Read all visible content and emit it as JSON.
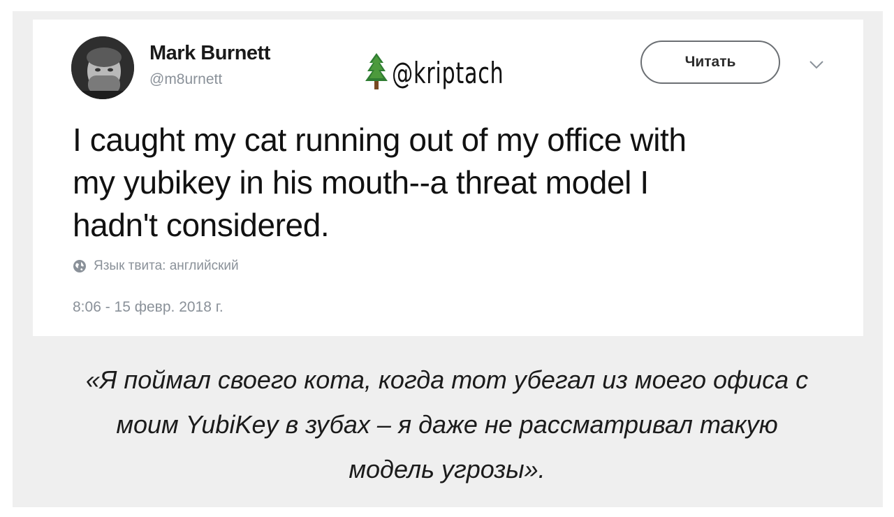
{
  "tweet": {
    "author_name": "Mark Burnett",
    "author_handle": "@m8urnett",
    "follow_label": "Читать",
    "text_lines": [
      "I caught my cat running out of my office with",
      "my yubikey in his mouth--a threat model I",
      "hadn't considered."
    ],
    "language_note": "Язык твита: английский",
    "timestamp": "8:06 - 15 февр. 2018 г."
  },
  "watermark": {
    "text": "@kriptach",
    "icon": "fir-tree-icon"
  },
  "translation": {
    "lines": [
      "«Я поймал своего кота, когда тот убегал из моего офиса с",
      "моим YubiKey в зубах – я даже не рассматривал такую",
      "модель угрозы»."
    ]
  },
  "colors": {
    "frame_background": "#efefef",
    "card_background": "#ffffff",
    "secondary_text": "#8a9199",
    "primary_text": "#111111",
    "tree_green": "#2f7d32"
  }
}
